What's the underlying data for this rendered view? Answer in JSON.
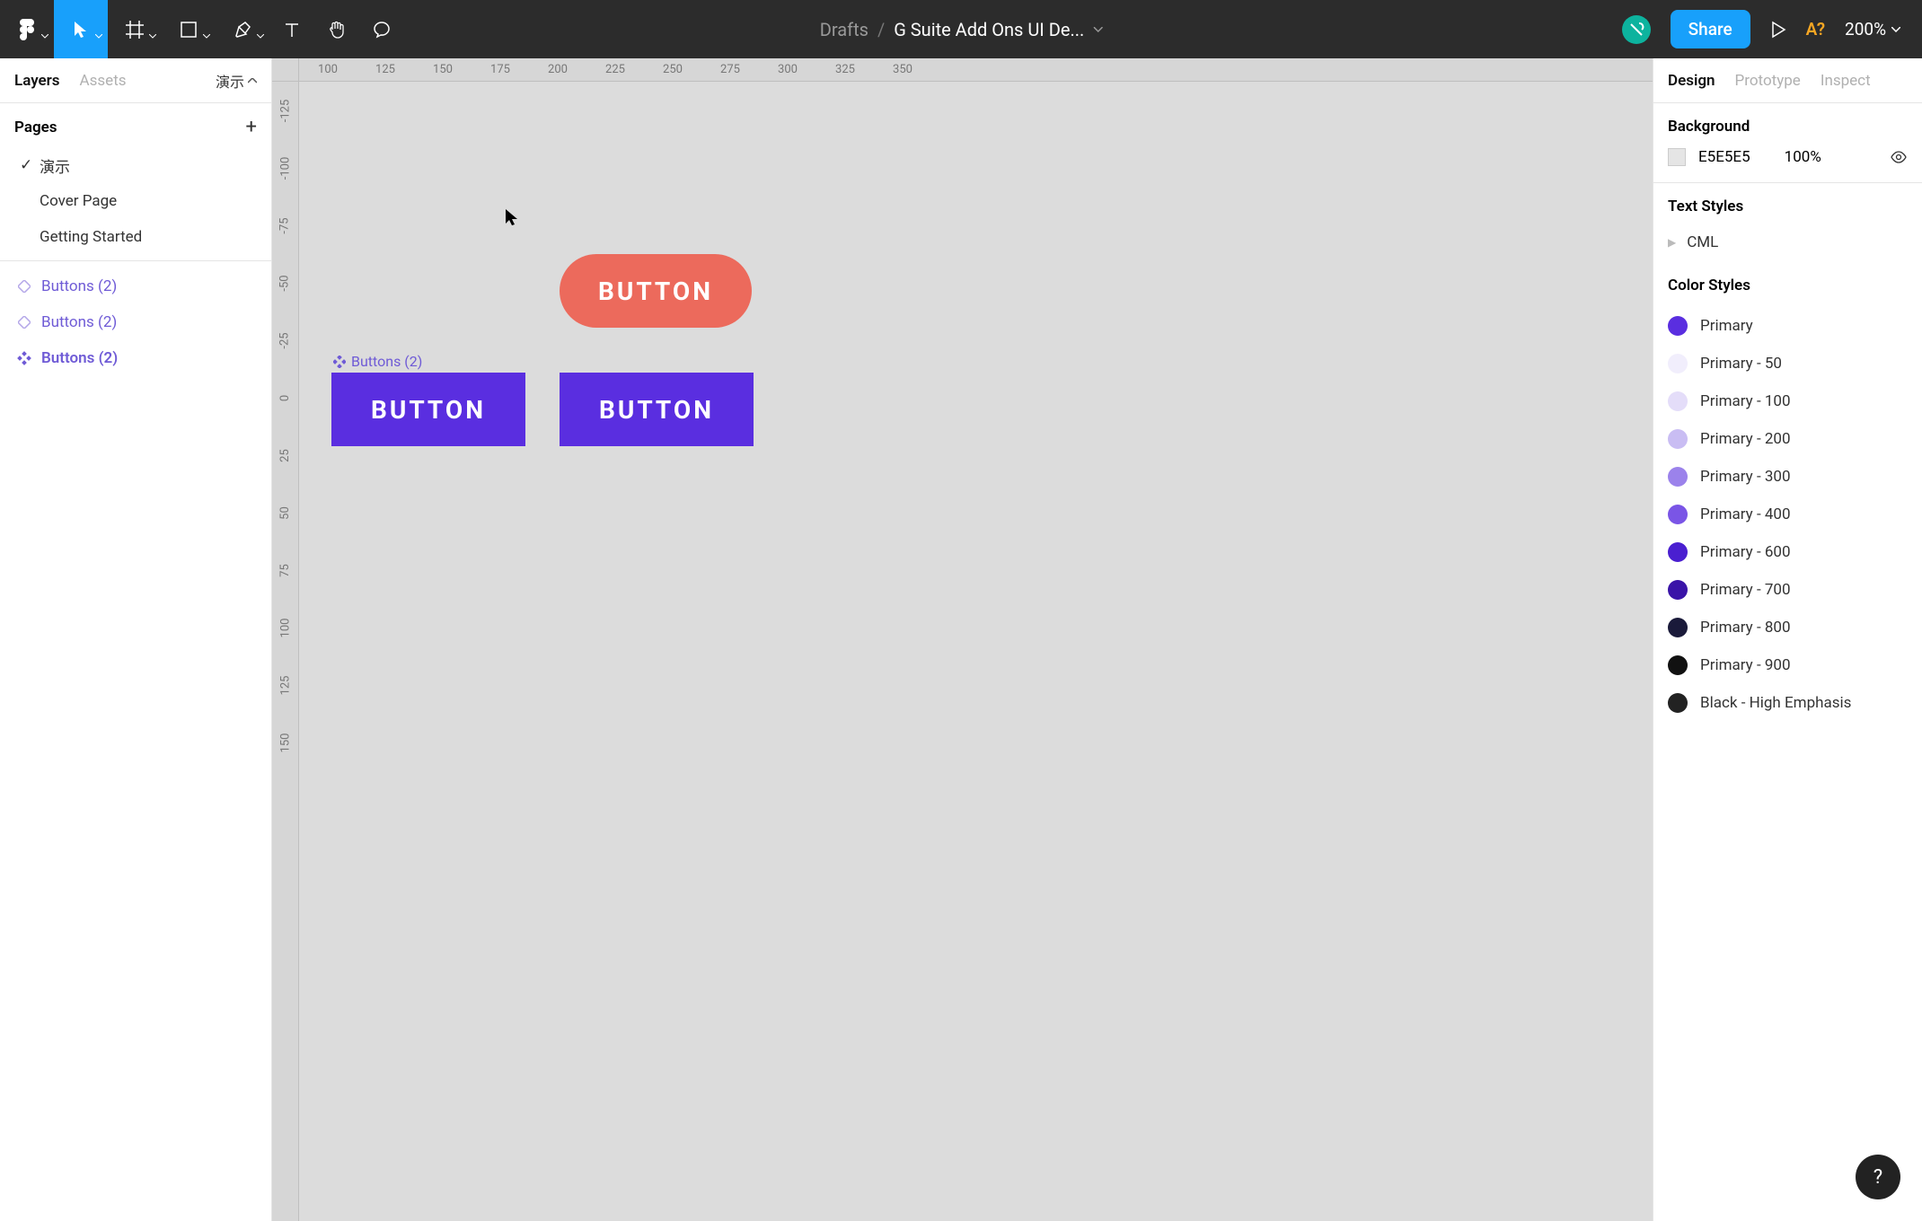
{
  "toolbar": {
    "drafts_label": "Drafts",
    "file_title": "G Suite Add Ons UI De...",
    "share_label": "Share",
    "missing_font": "A?",
    "zoom": "200%"
  },
  "left_panel": {
    "tabs": {
      "layers": "Layers",
      "assets": "Assets"
    },
    "page_toggle": "演示",
    "pages_heading": "Pages",
    "pages": [
      {
        "label": "演示",
        "current": true
      },
      {
        "label": "Cover Page",
        "current": false
      },
      {
        "label": "Getting Started",
        "current": false
      }
    ],
    "layers": [
      {
        "label": "Buttons   (2)",
        "icon": "diamond-outline",
        "bold": false
      },
      {
        "label": "Buttons   (2)",
        "icon": "diamond-outline",
        "bold": false
      },
      {
        "label": "Buttons   (2)",
        "icon": "component",
        "bold": true
      }
    ]
  },
  "canvas": {
    "ruler_top": [
      "100",
      "125",
      "150",
      "175",
      "200",
      "225",
      "250",
      "275",
      "300",
      "325",
      "350"
    ],
    "ruler_left": [
      "-125",
      "-100",
      "-75",
      "-50",
      "-25",
      "0",
      "25",
      "50",
      "75",
      "100",
      "125",
      "150"
    ],
    "frame_label": "Buttons   (2)",
    "buttons": {
      "coral": "BUTTON",
      "purple1": "BUTTON",
      "purple2": "BUTTON"
    }
  },
  "right_panel": {
    "tabs": {
      "design": "Design",
      "prototype": "Prototype",
      "inspect": "Inspect"
    },
    "background": {
      "heading": "Background",
      "hex": "E5E5E5",
      "opacity": "100%"
    },
    "text_styles": {
      "heading": "Text Styles",
      "item": "CML"
    },
    "color_styles": {
      "heading": "Color Styles",
      "items": [
        {
          "label": "Primary",
          "color": "#5a2ee0"
        },
        {
          "label": "Primary - 50",
          "color": "#f1eefc"
        },
        {
          "label": "Primary - 100",
          "color": "#e4ddf9"
        },
        {
          "label": "Primary - 200",
          "color": "#c9bdf3"
        },
        {
          "label": "Primary - 300",
          "color": "#9b82eb"
        },
        {
          "label": "Primary - 400",
          "color": "#7a55e6"
        },
        {
          "label": "Primary - 600",
          "color": "#4a1fd0"
        },
        {
          "label": "Primary - 700",
          "color": "#3a14a8"
        },
        {
          "label": "Primary - 800",
          "color": "#1a1a3a"
        },
        {
          "label": "Primary - 900",
          "color": "#111111"
        },
        {
          "label": "Black - High Emphasis",
          "color": "#222222"
        }
      ]
    }
  },
  "help": "?"
}
